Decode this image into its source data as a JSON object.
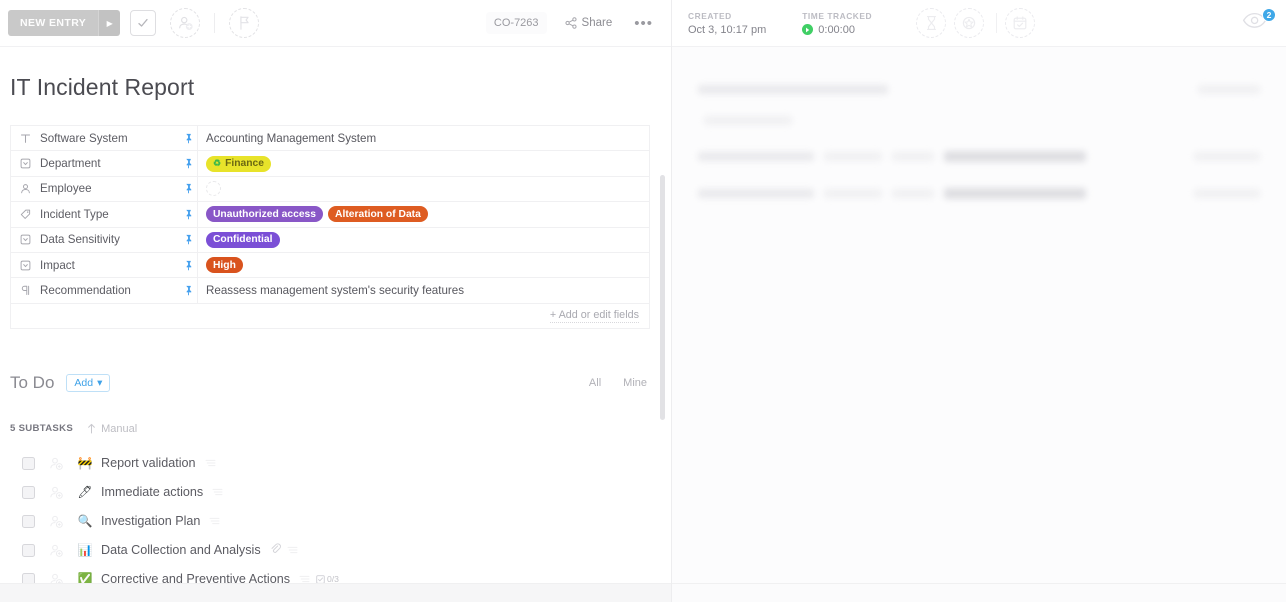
{
  "toolbar": {
    "new_entry_label": "NEW ENTRY",
    "caret_glyph": "▶",
    "task_id": "CO-7263",
    "share_label": "Share",
    "more_label": "•••",
    "icons": {
      "check": "check-icon",
      "add_assignee": "add-person-icon",
      "flag": "flag-icon",
      "share": "share-icon"
    }
  },
  "task": {
    "title": "IT Incident Report"
  },
  "fields": {
    "add_or_edit_label": "+ Add or edit fields",
    "rows": [
      {
        "icon": "text-field-icon",
        "icon_glyph": "T",
        "label": "Software System",
        "value_type": "text",
        "value": "Accounting Management System",
        "pinned": true
      },
      {
        "icon": "dropdown-field-icon",
        "icon_glyph": "▼",
        "label": "Department",
        "value_type": "tags",
        "tags": [
          {
            "text": "Finance",
            "color": "#e8e32a",
            "text_color": "#6b6813",
            "emoji": "♻"
          }
        ],
        "pinned": true
      },
      {
        "icon": "person-field-icon",
        "icon_glyph": "⚲",
        "label": "Employee",
        "value_type": "avatar-empty",
        "value": "",
        "pinned": true
      },
      {
        "icon": "label-field-icon",
        "icon_glyph": "◇",
        "label": "Incident Type",
        "value_type": "tags",
        "tags": [
          {
            "text": "Unauthorized access",
            "color": "#8957c7",
            "text_color": "#ffffff"
          },
          {
            "text": "Alteration of Data",
            "color": "#de5c22",
            "text_color": "#ffffff"
          }
        ],
        "pinned": true
      },
      {
        "icon": "dropdown-field-icon",
        "icon_glyph": "▼",
        "label": "Data Sensitivity",
        "value_type": "tags",
        "tags": [
          {
            "text": "Confidential",
            "color": "#7b4fd6",
            "text_color": "#ffffff"
          }
        ],
        "pinned": true
      },
      {
        "icon": "dropdown-field-icon",
        "icon_glyph": "▼",
        "label": "Impact",
        "value_type": "tags",
        "tags": [
          {
            "text": "High",
            "color": "#d9531e",
            "text_color": "#ffffff"
          }
        ],
        "pinned": true
      },
      {
        "icon": "paragraph-field-icon",
        "icon_glyph": "¶",
        "label": "Recommendation",
        "value_type": "text",
        "value": "Reassess management system's security features",
        "pinned": true
      }
    ]
  },
  "todo": {
    "title": "To Do",
    "add_label": "Add",
    "add_caret": "▾",
    "filter_all": "All",
    "filter_mine": "Mine",
    "subtask_count_label": "5 SUBTASKS",
    "sort_label": "Manual",
    "subtasks": [
      {
        "emoji": "🚧",
        "emoji_name": "construction-icon",
        "label": "Report validation",
        "has_lines": true,
        "has_attachment": false,
        "checklist": ""
      },
      {
        "emoji": "🖊",
        "emoji_name": "pen-icon",
        "label": "Immediate actions",
        "has_lines": true,
        "has_attachment": false,
        "checklist": ""
      },
      {
        "emoji": "🔍",
        "emoji_name": "magnifier-icon",
        "label": "Investigation Plan",
        "has_lines": true,
        "has_attachment": false,
        "checklist": ""
      },
      {
        "emoji": "📊",
        "emoji_name": "bar-chart-icon",
        "label": "Data Collection and Analysis",
        "has_lines": true,
        "has_attachment": true,
        "checklist": ""
      },
      {
        "emoji": "✅",
        "emoji_name": "green-check-icon",
        "label": "Corrective and Preventive Actions",
        "has_lines": true,
        "has_attachment": false,
        "checklist": "0/3"
      }
    ]
  },
  "detail_panel": {
    "created_label": "CREATED",
    "created_value": "Oct 3, 10:17 pm",
    "time_tracked_label": "TIME TRACKED",
    "time_tracked_value": "0:00:00",
    "icons": {
      "estimate": "hourglass-icon",
      "points": "star-badge-icon",
      "due_date": "calendar-check-icon",
      "watchers": "eye-icon"
    },
    "watchers_count": "2"
  }
}
